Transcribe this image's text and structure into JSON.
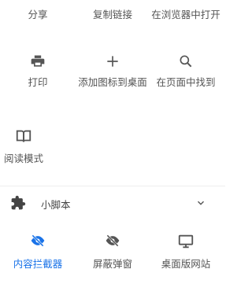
{
  "top_row": {
    "share_label": "分享",
    "copy_link_label": "复制链接",
    "open_in_browser_label": "在浏览器中打开"
  },
  "row2": {
    "print_label": "打印",
    "add_to_desktop_label": "添加图标到桌面",
    "find_in_page_label": "在页面中找到"
  },
  "row3": {
    "reading_mode_label": "阅读模式"
  },
  "scripts_section": {
    "label": "小脚本"
  },
  "row4": {
    "content_blocker_label": "内容拦截器",
    "block_popups_label": "屏蔽弹窗",
    "desktop_site_label": "桌面版网站"
  },
  "colors": {
    "accent": "#1a73e8",
    "icon": "#555555"
  }
}
